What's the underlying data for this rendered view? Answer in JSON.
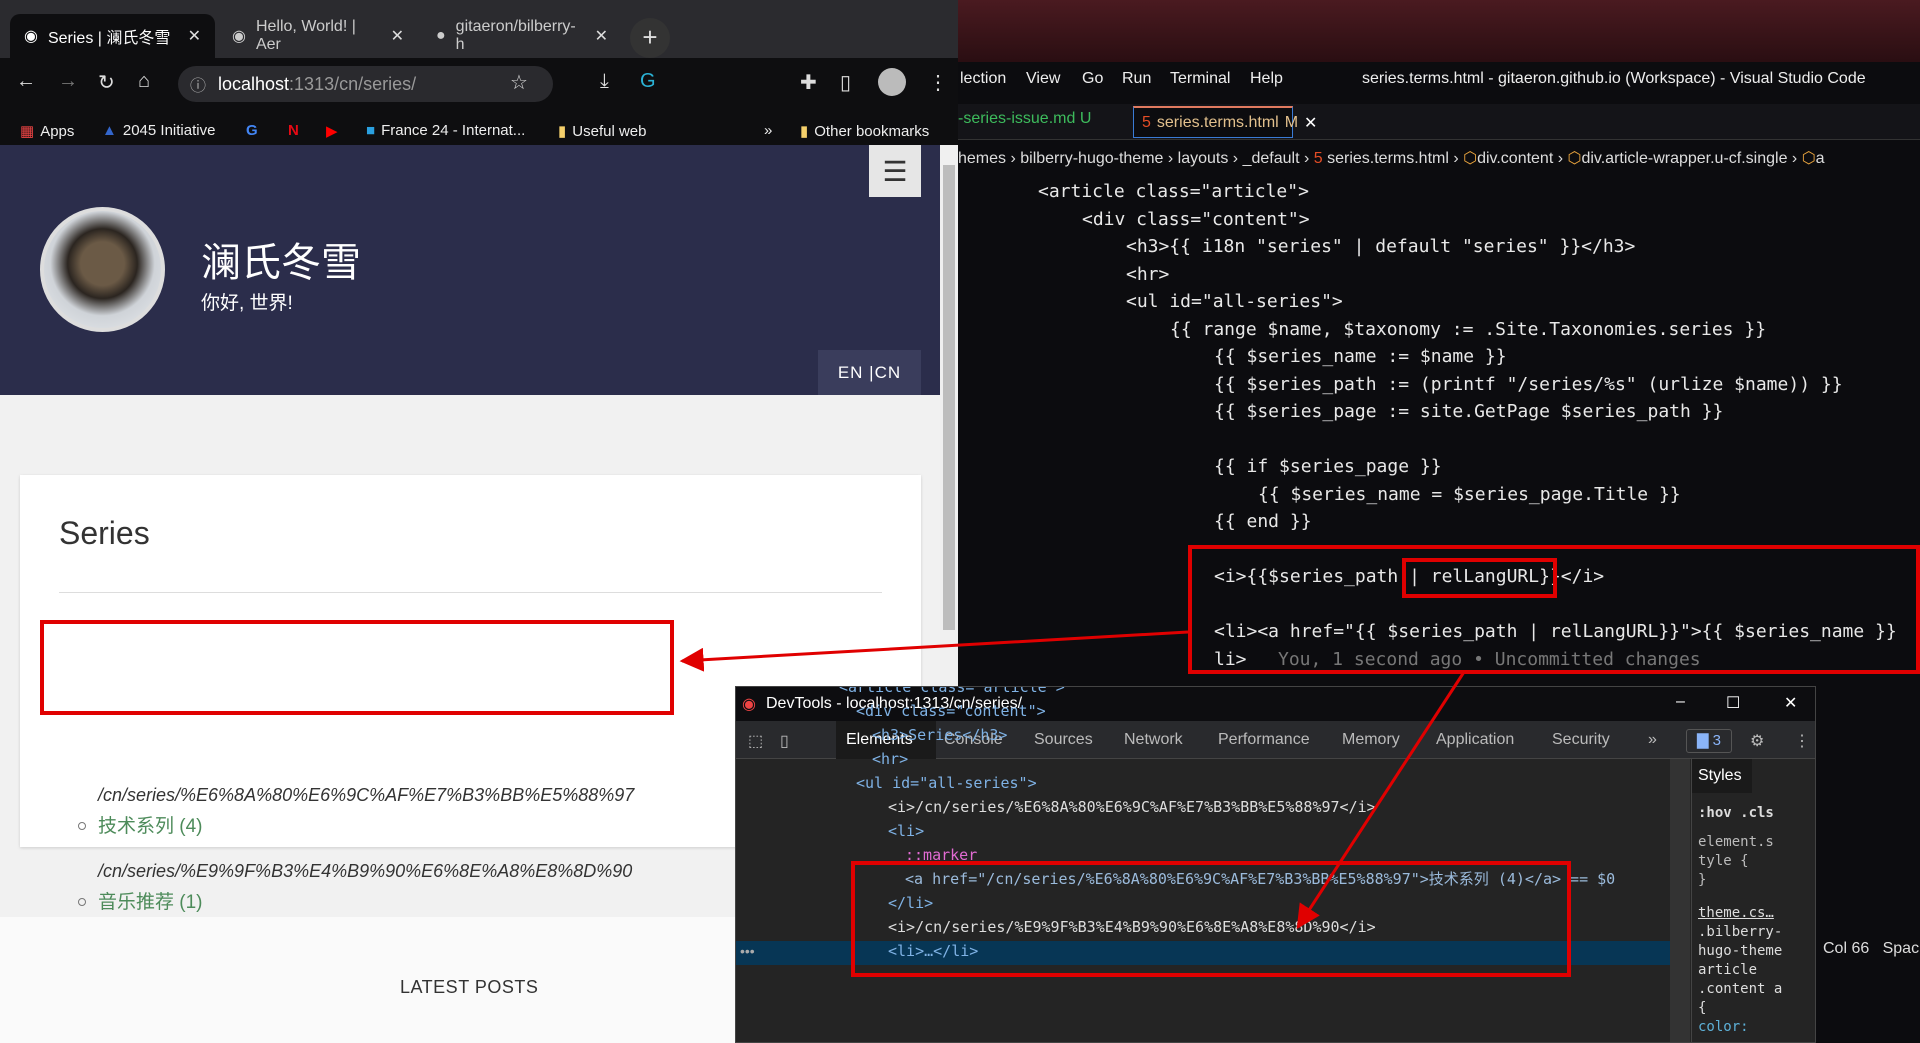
{
  "browser": {
    "tabs": [
      {
        "title": "Series | 澜氏冬雪",
        "active": true
      },
      {
        "title": "Hello, World! | Aer"
      },
      {
        "title": "gitaeron/bilberry-h"
      }
    ],
    "new_tab": "+",
    "url_host": "localhost",
    "url_rest": ":1313/cn/series/",
    "bookmarks": [
      "Apps",
      "2045 Initiative",
      "France 24 - Internat...",
      "Useful web"
    ],
    "bookmarks_more": "»",
    "other_bookmarks": "Other bookmarks",
    "page": {
      "site_name": "澜氏冬雪",
      "motto": "你好, 世界!",
      "menu_icon": "☰",
      "lang_switch": "EN |CN",
      "heading": "Series",
      "items": [
        {
          "path": "/cn/series/%E6%8A%80%E6%9C%AF%E7%B3%BB%E5%88%97",
          "label": "技术系列 (4)"
        },
        {
          "path": "/cn/series/%E9%9F%B3%E4%B9%90%E6%8E%A8%E8%8D%90",
          "label": "音乐推荐 (1)"
        }
      ],
      "latest_posts": "LATEST POSTS"
    }
  },
  "vscode": {
    "menu": [
      "lection",
      "View",
      "Go",
      "Run",
      "Terminal",
      "Help"
    ],
    "title": "series.terms.html - gitaeron.github.io (Workspace) - Visual Studio Code",
    "tabs": [
      {
        "label": "-series-issue.md",
        "badge": "U"
      },
      {
        "label": "series.terms.html",
        "badge": "M",
        "active": true
      }
    ],
    "breadcrumb": [
      "hemes",
      "bilberry-hugo-theme",
      "layouts",
      "_default",
      "series.terms.html",
      "div.content",
      "div.article-wrapper.u-cf.single",
      "a"
    ],
    "blame": "You, 1 second ago • Uncommitted changes",
    "status": {
      "col": "Col 66",
      "spaces": "Spac"
    },
    "code": [
      "<article class=\"article\">",
      "<div class=\"content\">",
      "<h3>{{ i18n \"series\" | default \"series\" }}</h3>",
      "<hr>",
      "<ul id=\"all-series\">",
      "{{ range $name, $taxonomy := .Site.Taxonomies.series }}",
      "{{ $series_name := $name }}",
      "{{ $series_path := (printf \"/series/%s\" (urlize $name)) }}",
      "{{ $series_page := site.GetPage $series_path }}",
      "",
      "{{ if $series_page }}",
      "{{ $series_name = $series_page.Title }}",
      "{{ end }}",
      "",
      "<i>{{$series_path | relLangURL}}</i>",
      "",
      "<li><a href=\"{{ $series_path | relLangURL}}\">{{ $series_name }}",
      "li>"
    ]
  },
  "devtools": {
    "title": "DevTools - localhost:1313/cn/series/",
    "tabs": [
      "Elements",
      "Console",
      "Sources",
      "Network",
      "Performance",
      "Memory",
      "Application",
      "Security"
    ],
    "more": "»",
    "issues_count": "3",
    "lines": [
      "<article class= article >",
      "<div class=\"content\">",
      "<h3>Series</h3>",
      "<hr>",
      "<ul id=\"all-series\">",
      "<i>/cn/series/%E6%8A%80%E6%9C%AF%E7%B3%BB%E5%88%97</i>",
      "<li>",
      "::marker",
      "<a href=\"/cn/series/%E6%8A%80%E6%9C%AF%E7%B3%BB%E5%88%97\">技术系列 (4)</a> == $0",
      "</li>",
      "<i>/cn/series/%E9%9F%B3%E4%B9%90%E6%8E%A8%E8%8D%90</i>",
      "<li>…</li>"
    ],
    "styles": {
      "tab": "Styles",
      "filter": ":hov .cls",
      "rules": [
        "element.s",
        "tyle {",
        "}",
        "theme.cs…",
        ".bilberry-",
        "hugo-theme",
        "article",
        ".content a",
        "{",
        "color:"
      ]
    }
  },
  "colors": {
    "annotation": "#e00000",
    "hero": "#2b2d4b",
    "series_link": "#4d8b5a"
  }
}
